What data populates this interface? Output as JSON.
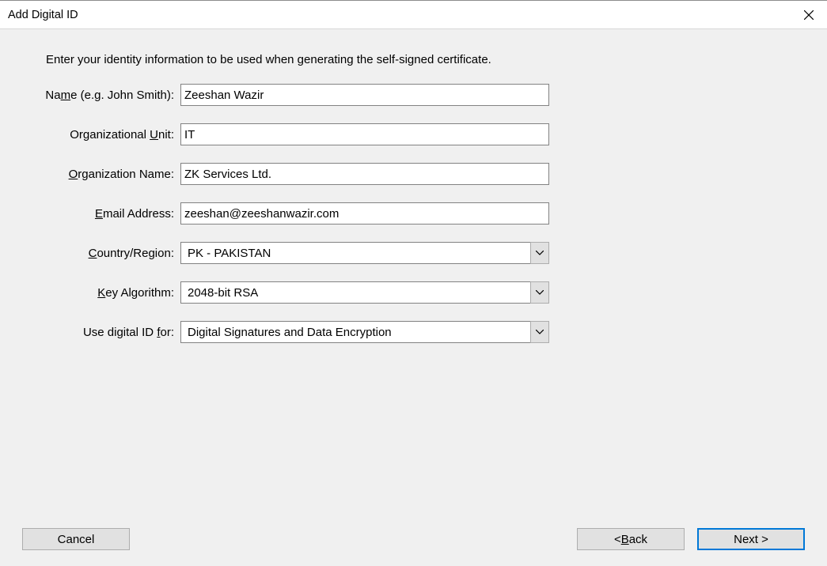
{
  "window": {
    "title": "Add Digital ID"
  },
  "intro": "Enter your identity information to be used when generating the self-signed certificate.",
  "labels": {
    "name_pre": "Na",
    "name_u": "m",
    "name_post": "e (e.g. John Smith):",
    "orgunit_pre": "Organizational ",
    "orgunit_u": "U",
    "orgunit_post": "nit:",
    "orgname_u": "O",
    "orgname_post": "rganization Name:",
    "email_u": "E",
    "email_post": "mail Address:",
    "country_u": "C",
    "country_post": "ountry/Region:",
    "keyalg_u": "K",
    "keyalg_post": "ey Algorithm:",
    "idfor_pre": "Use digital ID ",
    "idfor_u": "f",
    "idfor_post": "or:"
  },
  "fields": {
    "name": "Zeeshan Wazir",
    "org_unit": "IT",
    "org_name": "ZK Services Ltd.",
    "email": "zeeshan@zeeshanwazir.com",
    "country": "PK - PAKISTAN",
    "key_algorithm": "2048-bit RSA",
    "use_for": "Digital Signatures and Data Encryption"
  },
  "buttons": {
    "cancel": "Cancel",
    "back_pre": "< ",
    "back_u": "B",
    "back_post": "ack",
    "next": "Next >"
  }
}
